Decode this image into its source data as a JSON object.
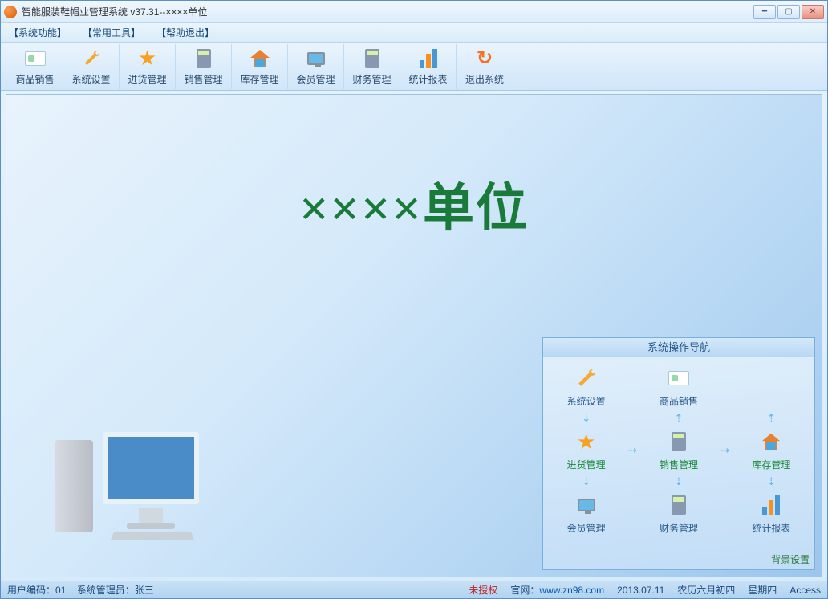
{
  "window": {
    "title": "智能服装鞋帽业管理系统 v37.31--××××单位"
  },
  "menu": {
    "items": [
      "【系统功能】",
      "【常用工具】",
      "【帮助退出】"
    ]
  },
  "toolbar": {
    "items": [
      {
        "label": "商品销售",
        "icon": "card-icon"
      },
      {
        "label": "系统设置",
        "icon": "wrench-icon"
      },
      {
        "label": "进货管理",
        "icon": "star-icon"
      },
      {
        "label": "销售管理",
        "icon": "calculator-icon"
      },
      {
        "label": "库存管理",
        "icon": "house-icon"
      },
      {
        "label": "会员管理",
        "icon": "monitor-icon"
      },
      {
        "label": "财务管理",
        "icon": "calculator-icon"
      },
      {
        "label": "统计报表",
        "icon": "chart-icon"
      },
      {
        "label": "退出系统",
        "icon": "exit-icon"
      }
    ]
  },
  "main": {
    "title": "××××单位"
  },
  "nav": {
    "header": "系统操作导航",
    "row1": [
      {
        "label": "系统设置",
        "icon": "wrench-icon",
        "green": false
      },
      {
        "label": "商品销售",
        "icon": "card-icon",
        "green": false
      }
    ],
    "row2": [
      {
        "label": "进货管理",
        "icon": "star-icon",
        "green": true
      },
      {
        "label": "销售管理",
        "icon": "calculator-icon",
        "green": true
      },
      {
        "label": "库存管理",
        "icon": "house-icon",
        "green": true
      }
    ],
    "row3": [
      {
        "label": "会员管理",
        "icon": "monitor-icon",
        "green": false
      },
      {
        "label": "财务管理",
        "icon": "calculator-icon",
        "green": false
      },
      {
        "label": "统计报表",
        "icon": "chart-icon",
        "green": false
      }
    ],
    "bg_setting": "背景设置"
  },
  "status": {
    "user_code_label": "用户编码：",
    "user_code": "01",
    "admin_label": "系统管理员：",
    "admin": "张三",
    "unauth": "未授权",
    "site_label": "官网：",
    "site": "www.zn98.com",
    "date": "2013.07.11",
    "lunar": "农历六月初四",
    "weekday": "星期四",
    "db": "Access"
  }
}
